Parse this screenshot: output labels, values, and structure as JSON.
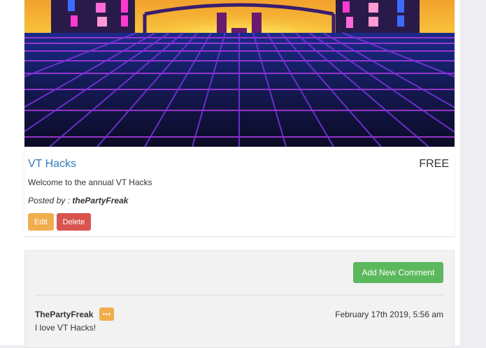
{
  "event": {
    "title": "VT Hacks",
    "price": "FREE",
    "description": "Welcome to the annual VT Hacks",
    "posted_by_label": "Posted by :",
    "posted_by_user": "thePartyFreak",
    "edit_label": "Edit",
    "delete_label": "Delete",
    "image_icon": "synthwave-grid-image"
  },
  "comments": {
    "add_label": "Add New Comment",
    "items": [
      {
        "author": "ThePartyFreak",
        "date": "February 17th 2019, 5:56 am",
        "text": "I love VT Hacks!",
        "menu_icon": "more-horizontal-icon"
      }
    ]
  },
  "colors": {
    "link": "#337ab7",
    "warning": "#f0ad4e",
    "danger": "#d9534f",
    "success": "#5cb85c"
  }
}
